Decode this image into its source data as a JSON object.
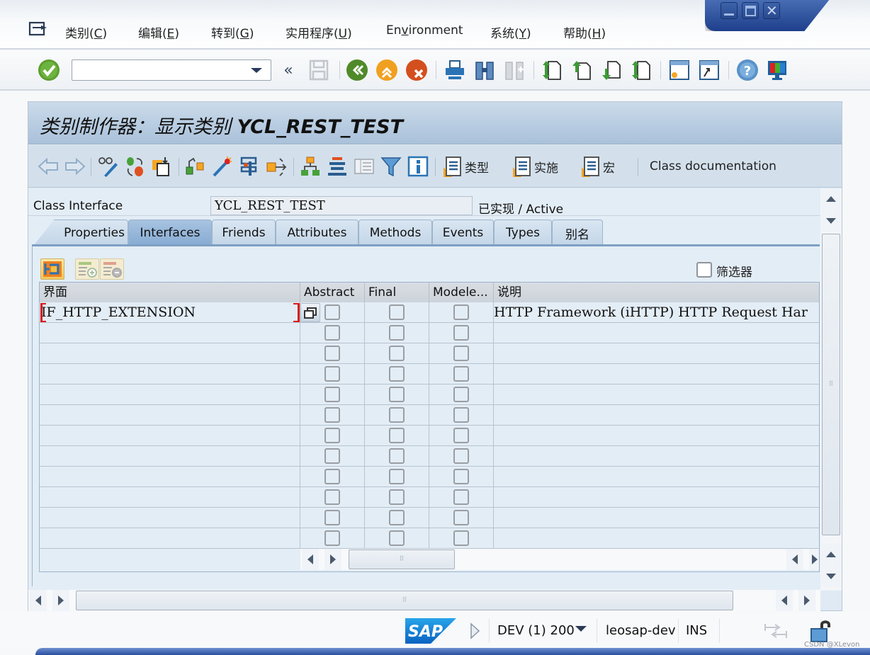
{
  "window": {
    "controls": [
      "minimize",
      "maximize",
      "close"
    ]
  },
  "menubar": {
    "items": [
      {
        "label": "类别(",
        "key": "C",
        "suffix": ")"
      },
      {
        "label": "编辑(",
        "key": "E",
        "suffix": ")"
      },
      {
        "label": "转到(",
        "key": "G",
        "suffix": ")"
      },
      {
        "label": "实用程序(",
        "key": "U",
        "suffix": ")"
      },
      {
        "label": "En",
        "key": "v",
        "suffix": "ironment"
      },
      {
        "label": "系统(",
        "key": "Y",
        "suffix": ")"
      },
      {
        "label": "帮助(",
        "key": "H",
        "suffix": ")"
      }
    ]
  },
  "std_toolbar": {
    "command_field_value": "",
    "command_field_placeholder": "",
    "icons": [
      "enter-icon",
      "back-arrows-icon",
      "save-icon",
      "back-icon",
      "exit-icon",
      "cancel-icon",
      "print-icon",
      "find-icon",
      "find-next-icon",
      "first-page-icon",
      "previous-page-icon",
      "next-page-icon",
      "last-page-icon",
      "new-session-icon",
      "shortcut-icon",
      "help-icon",
      "customize-layout-icon"
    ]
  },
  "title": {
    "prefix": "类别制作器：显示类别 ",
    "object": "YCL_REST_TEST"
  },
  "app_toolbar": {
    "icons": [
      "back-arrow-icon",
      "forward-arrow-icon",
      "display-change-icon",
      "active-inactive-icon",
      "other-object-icon",
      "check-icon",
      "activate-icon",
      "test-icon",
      "where-used-icon",
      "object-list-icon",
      "display-navigation-icon",
      "worklist-icon",
      "filter-icon",
      "info-icon"
    ],
    "buttons": [
      {
        "label": "类型"
      },
      {
        "label": "实施"
      },
      {
        "label": "宏"
      }
    ],
    "class_documentation": "Class documentation"
  },
  "header": {
    "class_interface_label": "Class Interface",
    "class_interface_value": "YCL_REST_TEST",
    "status": "已实现 / Active"
  },
  "tabs": [
    {
      "label": "Properties",
      "active": false
    },
    {
      "label": "Interfaces",
      "active": true
    },
    {
      "label": "Friends",
      "active": false
    },
    {
      "label": "Attributes",
      "active": false
    },
    {
      "label": "Methods",
      "active": false
    },
    {
      "label": "Events",
      "active": false
    },
    {
      "label": "Types",
      "active": false
    },
    {
      "label": "别名",
      "active": false
    }
  ],
  "interfaces_pane": {
    "filter_label": "筛选器",
    "filter_checked": false,
    "columns": [
      "界面",
      "Abstract",
      "Final",
      "Modele...",
      "说明"
    ],
    "rows": [
      {
        "interface": "IF_HTTP_EXTENSION",
        "abstract": false,
        "final": false,
        "modeled": false,
        "description": "HTTP Framework (iHTTP) HTTP Request Har"
      },
      {
        "interface": "",
        "abstract": false,
        "final": false,
        "modeled": false,
        "description": ""
      },
      {
        "interface": "",
        "abstract": false,
        "final": false,
        "modeled": false,
        "description": ""
      },
      {
        "interface": "",
        "abstract": false,
        "final": false,
        "modeled": false,
        "description": ""
      },
      {
        "interface": "",
        "abstract": false,
        "final": false,
        "modeled": false,
        "description": ""
      },
      {
        "interface": "",
        "abstract": false,
        "final": false,
        "modeled": false,
        "description": ""
      },
      {
        "interface": "",
        "abstract": false,
        "final": false,
        "modeled": false,
        "description": ""
      },
      {
        "interface": "",
        "abstract": false,
        "final": false,
        "modeled": false,
        "description": ""
      },
      {
        "interface": "",
        "abstract": false,
        "final": false,
        "modeled": false,
        "description": ""
      },
      {
        "interface": "",
        "abstract": false,
        "final": false,
        "modeled": false,
        "description": ""
      },
      {
        "interface": "",
        "abstract": false,
        "final": false,
        "modeled": false,
        "description": ""
      },
      {
        "interface": "",
        "abstract": false,
        "final": false,
        "modeled": false,
        "description": ""
      }
    ]
  },
  "statusbar": {
    "logo": "SAP",
    "system": "DEV (1) 200",
    "server": "leosap-dev",
    "mode": "INS",
    "watermark": "CSDN @XLevon"
  }
}
